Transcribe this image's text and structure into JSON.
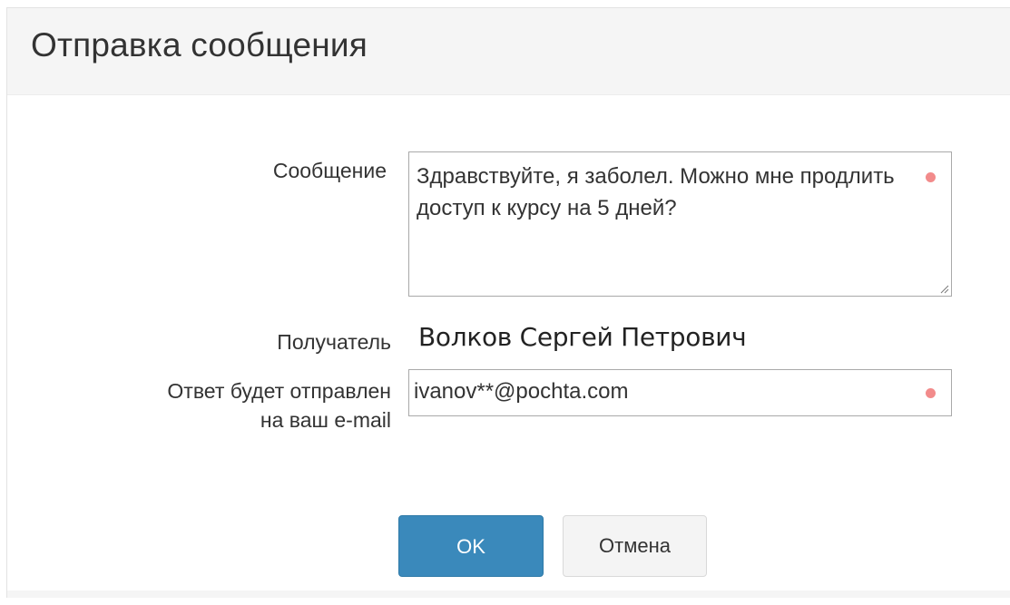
{
  "dialog": {
    "title": "Отправка сообщения"
  },
  "form": {
    "message_label": "Сообщение",
    "message_value": "Здравствуйте, я заболел. Можно мне продлить доступ к курсу на 5 дней?",
    "recipient_label": "Получатель",
    "recipient_value": "Волков Сергей Петрович",
    "reply_label": "Ответ будет отправлен\nна ваш e-mail",
    "email_value": "ivanov**@pochta.com"
  },
  "buttons": {
    "ok_label": "OK",
    "cancel_label": "Отмена"
  },
  "colors": {
    "primary_button": "#3a89bb",
    "required_indicator": "#f28b8b",
    "header_background": "#f5f5f5"
  },
  "icons": {
    "required": "required-dot-icon",
    "resize": "resize-grip-icon"
  }
}
